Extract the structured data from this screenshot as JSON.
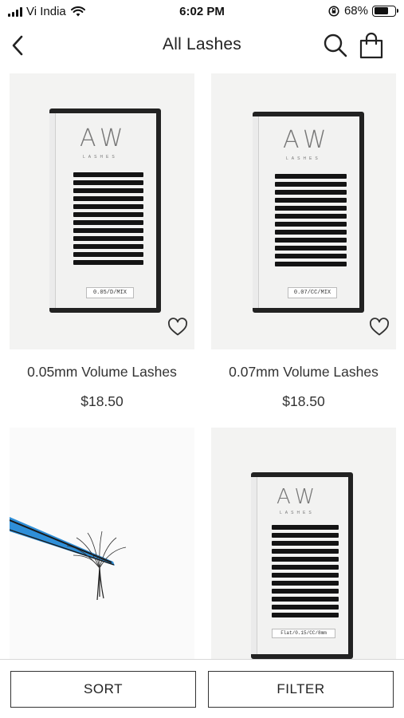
{
  "status_bar": {
    "carrier": "Vi India",
    "time": "6:02 PM",
    "battery": "68%",
    "battery_level": 0.68
  },
  "header": {
    "title": "All Lashes",
    "back_icon": "chevron-left-icon",
    "search_icon": "search-icon",
    "bag_icon": "shopping-bag-icon"
  },
  "products": [
    {
      "name": "0.05mm Volume Lashes",
      "price": "$18.50",
      "label": "0.05/D/MIX"
    },
    {
      "name": "0.07mm Volume Lashes",
      "price": "$18.50",
      "label": "0.07/CC/MIX"
    },
    {
      "name": "",
      "price": ""
    },
    {
      "name": "",
      "price": "",
      "label": "Flat/0.15/CC/8mm"
    }
  ],
  "brand": {
    "logo": "AW",
    "sub": "LASHES"
  },
  "bottom_bar": {
    "sort_label": "SORT",
    "filter_label": "FILTER"
  },
  "colors": {
    "tweezer_blue": "#2f8fd8",
    "lash_black": "#141414"
  }
}
